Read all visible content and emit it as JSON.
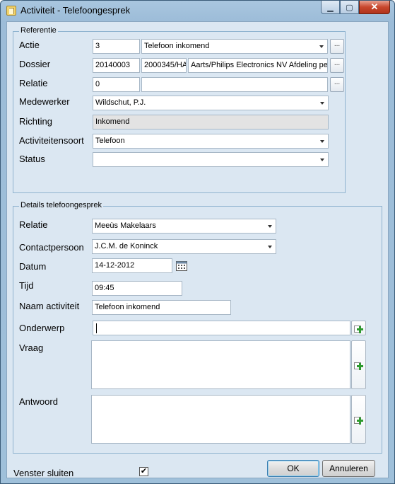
{
  "window": {
    "title": "Activiteit - Telefoongesprek",
    "min_symbol": "▁",
    "max_symbol": "▢",
    "close_symbol": "✕"
  },
  "referentie": {
    "legend": "Referentie",
    "actie_label": "Actie",
    "actie_id": "3",
    "actie_value": "Telefoon inkomend",
    "dossier_label": "Dossier",
    "dossier_nr": "20140003",
    "dossier_code": "2000345/HA",
    "dossier_naam": "Aarts/Philips Electronics NV Afdeling per",
    "relatie_label": "Relatie",
    "relatie_id": "0",
    "relatie_value": "",
    "medewerker_label": "Medewerker",
    "medewerker_value": "Wildschut, P.J.",
    "richting_label": "Richting",
    "richting_value": "Inkomend",
    "activiteitensoort_label": "Activiteitensoort",
    "activiteitensoort_value": "Telefoon",
    "status_label": "Status",
    "status_value": "",
    "browse_label": "..."
  },
  "details": {
    "legend": "Details telefoongesprek",
    "relatie_label": "Relatie",
    "relatie_value": "Meeùs Makelaars",
    "contactpersoon_label": "Contactpersoon",
    "contactpersoon_value": "J.C.M. de Koninck",
    "datum_label": "Datum",
    "datum_value": "14-12-2012",
    "tijd_label": "Tijd",
    "tijd_value": "09:45",
    "naam_label": "Naam activiteit",
    "naam_value": "Telefoon inkomend",
    "onderwerp_label": "Onderwerp",
    "onderwerp_value": "",
    "vraag_label": "Vraag",
    "vraag_value": "",
    "antwoord_label": "Antwoord",
    "antwoord_value": ""
  },
  "footer": {
    "venster_sluiten_label": "Venster sluiten",
    "venster_sluiten_checked": "✔",
    "ok_label": "OK",
    "annuleren_label": "Annuleren"
  },
  "icons": {
    "calendar": "calendar-icon",
    "plus": "add-green-plus-icon"
  }
}
